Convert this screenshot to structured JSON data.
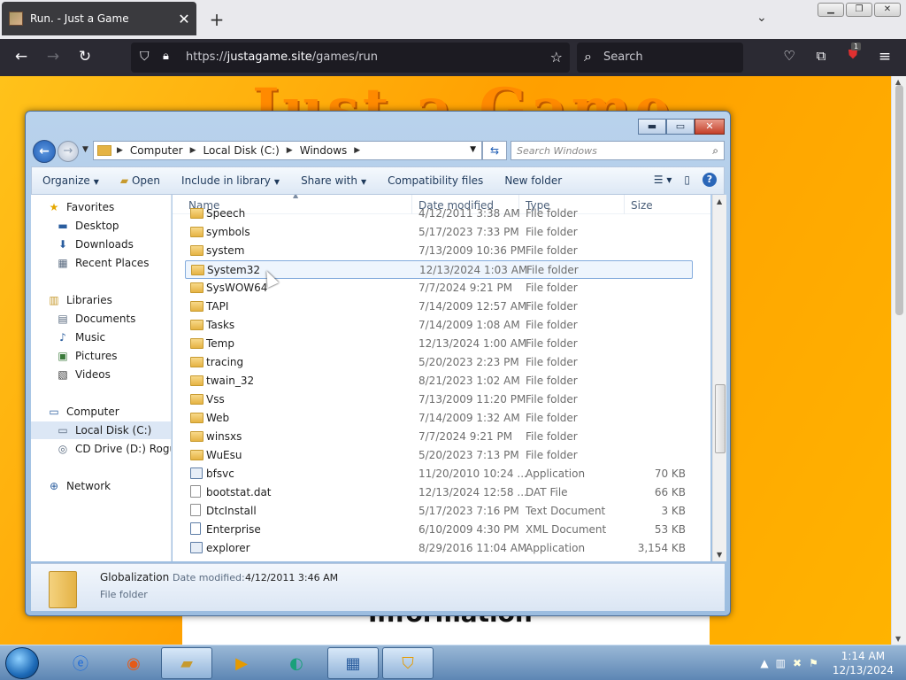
{
  "browser": {
    "tab_title": "Run. - Just a Game",
    "tab_close": "✕",
    "new_tab": "+",
    "url_scheme": "https://",
    "url_host": "justagame.site",
    "url_path": "/games/run",
    "search_placeholder": "Search",
    "extension_badge": "1"
  },
  "page": {
    "title": "Just a Game",
    "card_text": "Information"
  },
  "explorer": {
    "breadcrumbs": [
      "Computer",
      "Local Disk (C:)",
      "Windows"
    ],
    "search_placeholder": "Search Windows",
    "toolbar": {
      "organize": "Organize",
      "open": "Open",
      "include_in_library": "Include in library",
      "share_with": "Share with",
      "compatibility_files": "Compatibility files",
      "new_folder": "New folder"
    },
    "nav": {
      "favorites": "Favorites",
      "desktop": "Desktop",
      "downloads": "Downloads",
      "recent_places": "Recent Places",
      "libraries": "Libraries",
      "documents": "Documents",
      "music": "Music",
      "pictures": "Pictures",
      "videos": "Videos",
      "computer": "Computer",
      "local_disk": "Local Disk (C:)",
      "cd_drive": "CD Drive (D:) Rogue",
      "network": "Network"
    },
    "columns": {
      "name": "Name",
      "date_modified": "Date modified",
      "type": "Type",
      "size": "Size"
    },
    "rows": [
      {
        "name": "Speech",
        "date": "4/12/2011 3:38 AM",
        "type": "File folder",
        "size": "",
        "icon": "folder"
      },
      {
        "name": "symbols",
        "date": "5/17/2023 7:33 PM",
        "type": "File folder",
        "size": "",
        "icon": "folder"
      },
      {
        "name": "system",
        "date": "7/13/2009 10:36 PM",
        "type": "File folder",
        "size": "",
        "icon": "folder"
      },
      {
        "name": "System32",
        "date": "12/13/2024 1:03 AM",
        "type": "File folder",
        "size": "",
        "icon": "folder"
      },
      {
        "name": "SysWOW64",
        "date": "7/7/2024 9:21 PM",
        "type": "File folder",
        "size": "",
        "icon": "folder"
      },
      {
        "name": "TAPI",
        "date": "7/14/2009 12:57 AM",
        "type": "File folder",
        "size": "",
        "icon": "folder"
      },
      {
        "name": "Tasks",
        "date": "7/14/2009 1:08 AM",
        "type": "File folder",
        "size": "",
        "icon": "folder"
      },
      {
        "name": "Temp",
        "date": "12/13/2024 1:00 AM",
        "type": "File folder",
        "size": "",
        "icon": "folder"
      },
      {
        "name": "tracing",
        "date": "5/20/2023 2:23 PM",
        "type": "File folder",
        "size": "",
        "icon": "folder"
      },
      {
        "name": "twain_32",
        "date": "8/21/2023 1:02 AM",
        "type": "File folder",
        "size": "",
        "icon": "folder"
      },
      {
        "name": "Vss",
        "date": "7/13/2009 11:20 PM",
        "type": "File folder",
        "size": "",
        "icon": "folder"
      },
      {
        "name": "Web",
        "date": "7/14/2009 1:32 AM",
        "type": "File folder",
        "size": "",
        "icon": "folder"
      },
      {
        "name": "winsxs",
        "date": "7/7/2024 9:21 PM",
        "type": "File folder",
        "size": "",
        "icon": "folder"
      },
      {
        "name": "WuEsu",
        "date": "5/20/2023 7:13 PM",
        "type": "File folder",
        "size": "",
        "icon": "folder"
      },
      {
        "name": "bfsvc",
        "date": "11/20/2010 10:24 ...",
        "type": "Application",
        "size": "70 KB",
        "icon": "app"
      },
      {
        "name": "bootstat.dat",
        "date": "12/13/2024 12:58 ...",
        "type": "DAT File",
        "size": "66 KB",
        "icon": "file"
      },
      {
        "name": "DtcInstall",
        "date": "5/17/2023 7:16 PM",
        "type": "Text Document",
        "size": "3 KB",
        "icon": "file"
      },
      {
        "name": "Enterprise",
        "date": "6/10/2009 4:30 PM",
        "type": "XML Document",
        "size": "53 KB",
        "icon": "xml"
      },
      {
        "name": "explorer",
        "date": "8/29/2016 11:04 AM",
        "type": "Application",
        "size": "3,154 KB",
        "icon": "app"
      }
    ],
    "selected_row": "System32",
    "details": {
      "name": "Globalization",
      "date_label": "Date modified:",
      "date_value": "4/12/2011 3:46 AM",
      "type": "File folder"
    }
  },
  "taskbar": {
    "time": "1:14 AM",
    "date": "12/13/2024"
  }
}
